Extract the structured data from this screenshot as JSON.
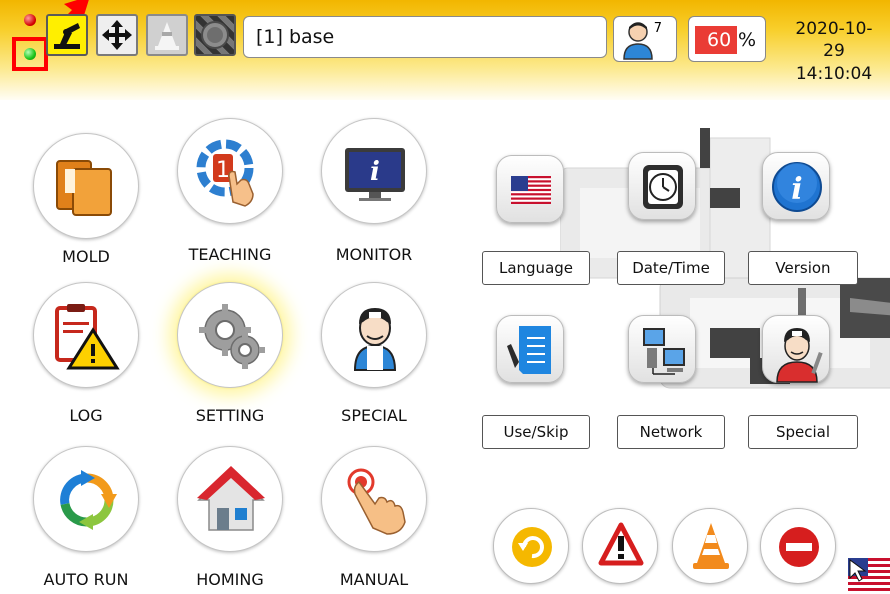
{
  "header": {
    "mold_name": "[1] base",
    "user_count": "7",
    "speed_percent": "60",
    "speed_unit": "%",
    "date": "2020-10-29",
    "time": "14:10:04"
  },
  "main_menu": [
    {
      "label": "MOLD",
      "icon": "mold-folder-icon"
    },
    {
      "label": "TEACHING",
      "icon": "teaching-icon"
    },
    {
      "label": "MONITOR",
      "icon": "monitor-icon"
    },
    {
      "label": "LOG",
      "icon": "log-warning-icon"
    },
    {
      "label": "SETTING",
      "icon": "gears-icon",
      "active": true
    },
    {
      "label": "SPECIAL",
      "icon": "worker-icon"
    },
    {
      "label": "AUTO RUN",
      "icon": "cycle-arrows-icon"
    },
    {
      "label": "HOMING",
      "icon": "house-icon"
    },
    {
      "label": "MANUAL",
      "icon": "hand-press-icon"
    }
  ],
  "settings_menu": [
    {
      "label": "Language",
      "icon": "us-flag-icon"
    },
    {
      "label": "Date/Time",
      "icon": "clock-icon"
    },
    {
      "label": "Version",
      "icon": "info-icon"
    },
    {
      "label": "Use/Skip",
      "icon": "checklist-icon"
    },
    {
      "label": "Network",
      "icon": "network-computers-icon"
    },
    {
      "label": "Special",
      "icon": "mechanic-icon"
    }
  ],
  "colors": {
    "header_gold": "#f2b600",
    "speed_red": "#ea3c35",
    "highlight": "#ff0000"
  }
}
